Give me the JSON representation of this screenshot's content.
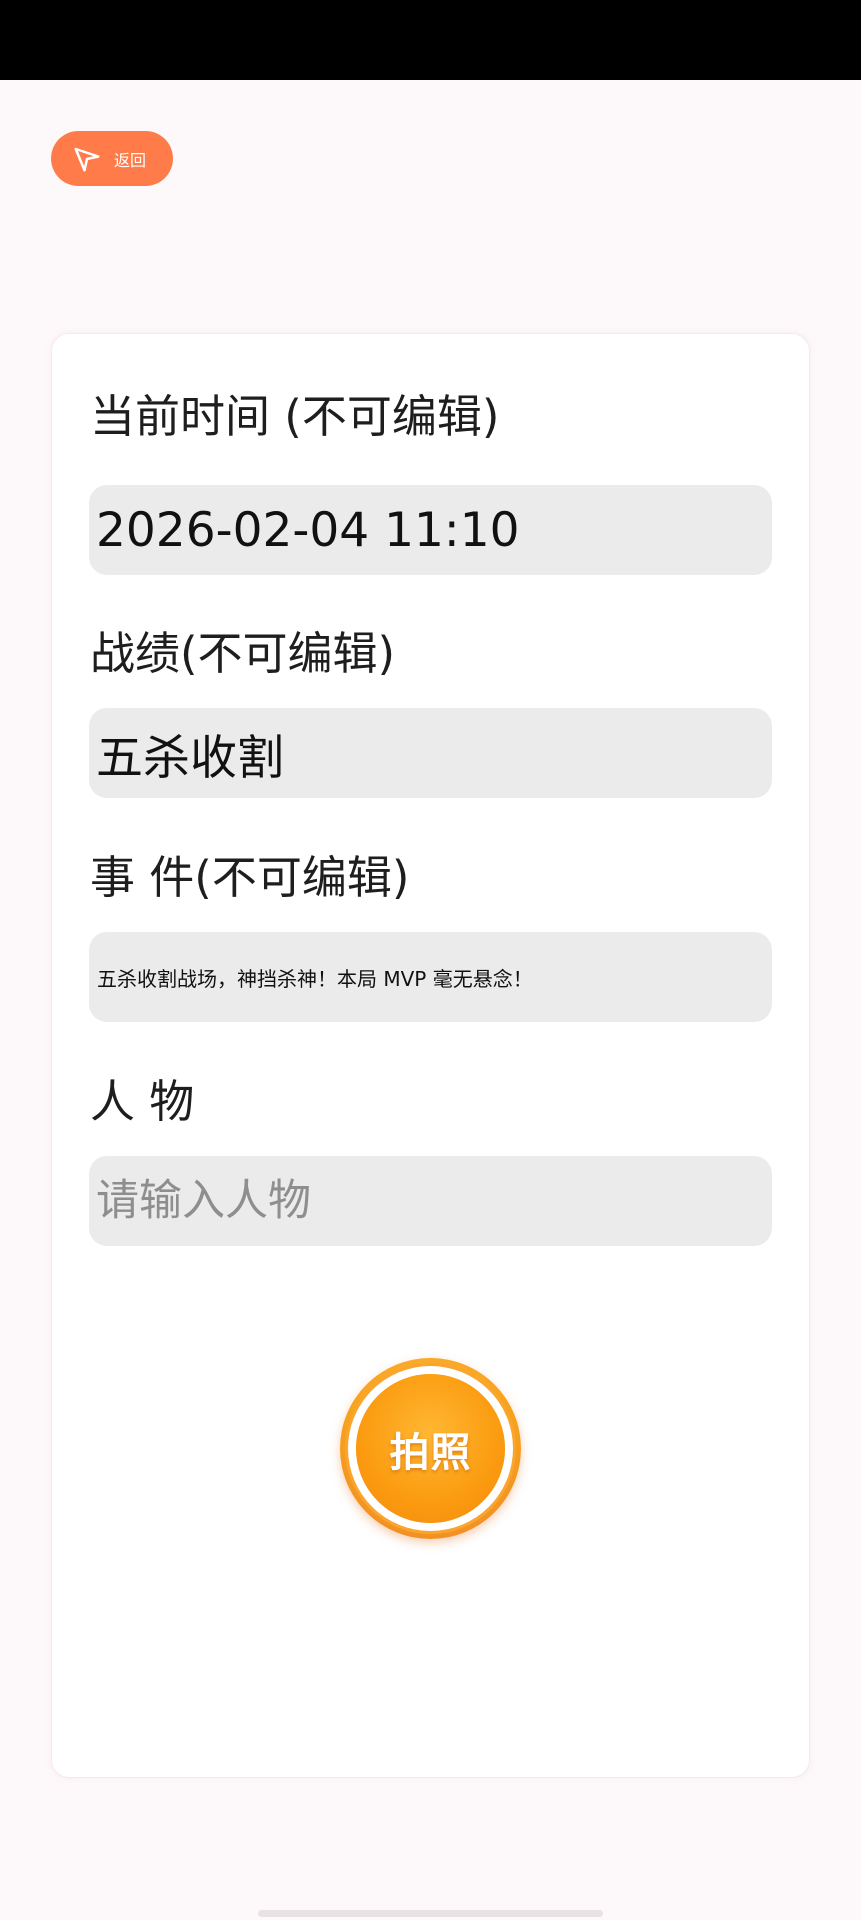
{
  "header": {
    "back_label": "返回"
  },
  "form": {
    "time_label": "当前时间 (不可编辑)",
    "time_value": "2026-02-04 11:10",
    "record_label": "战绩(不可编辑)",
    "record_value": "五杀收割",
    "event_label": "事 件(不可编辑)",
    "event_value": "五杀收割战场，神挡杀神！本局 MVP 毫无悬念！",
    "person_label": "人 物",
    "person_placeholder": "请输入人物",
    "person_value": ""
  },
  "actions": {
    "photo_label": "拍照"
  },
  "colors": {
    "accent": "#ff7c4a",
    "photo_button": "#f7a21c",
    "field_bg": "#ebebeb"
  },
  "icons": {
    "back": "send-arrow-icon"
  }
}
